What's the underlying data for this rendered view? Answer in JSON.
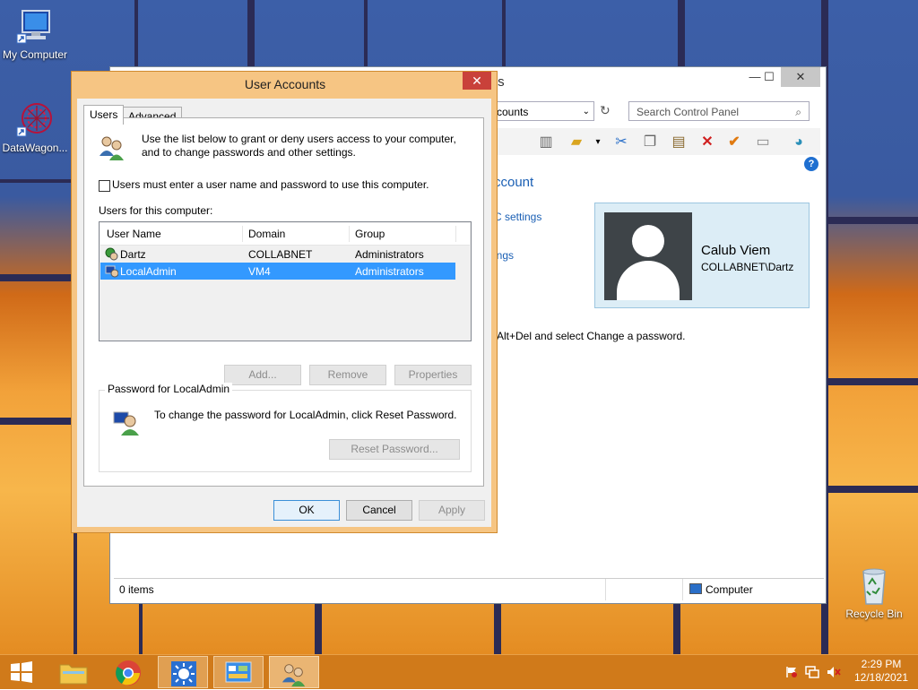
{
  "desktop": {
    "icons": [
      {
        "label": "My Computer",
        "icon": "computer-icon"
      },
      {
        "label": "DataWagon...",
        "icon": "datawagon-icon"
      },
      {
        "label": "Recycle Bin",
        "icon": "recycle-bin-icon"
      }
    ]
  },
  "explorer": {
    "title_fragment": "ts",
    "minimize": "—",
    "maximize": "☐",
    "close": "✕",
    "address": "ccounts",
    "search_placeholder": "Search Control Panel",
    "heading": "ccount",
    "links": [
      "C settings",
      "ings"
    ],
    "hint_text": "Alt+Del and select Change a password.",
    "profile": {
      "name": "Calub Viem",
      "account": "COLLABNET\\Dartz"
    },
    "status_items": "0 items",
    "status_location": "Computer",
    "help": "?"
  },
  "dialog": {
    "title": "User Accounts",
    "close": "✕",
    "tabs": [
      {
        "label": "Users"
      },
      {
        "label": "Advanced"
      }
    ],
    "intro_line1": "Use the list below to grant or deny users access to your computer,",
    "intro_line2": "and to change passwords and other settings.",
    "checkbox_label": "Users must enter a user name and password to use this computer.",
    "list_label": "Users for this computer:",
    "columns": [
      "User Name",
      "Domain",
      "Group"
    ],
    "rows": [
      {
        "user": "Dartz",
        "domain": "COLLABNET",
        "group": "Administrators",
        "selected": false
      },
      {
        "user": "LocalAdmin",
        "domain": "VM4",
        "group": "Administrators",
        "selected": true
      }
    ],
    "buttons": {
      "add": "Add...",
      "remove": "Remove",
      "properties": "Properties"
    },
    "password_group": "Password for LocalAdmin",
    "password_text": "To change the password for LocalAdmin, click Reset Password.",
    "reset_button": "Reset Password...",
    "ok": "OK",
    "cancel": "Cancel",
    "apply": "Apply"
  },
  "taskbar": {
    "time": "2:29 PM",
    "date": "12/18/2021"
  }
}
